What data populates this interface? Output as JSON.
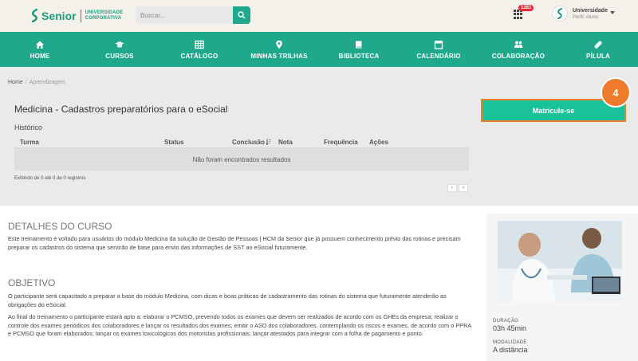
{
  "header": {
    "brand": "Senior",
    "brand_sub_1": "UNIVERSIDADE",
    "brand_sub_2": "CORPORATIVA",
    "search_placeholder": "Buscar...",
    "notifications": "1281",
    "user_name": "Universidade",
    "user_role": "Perfil: Aluno"
  },
  "nav": [
    {
      "label": "HOME",
      "icon": "home-icon"
    },
    {
      "label": "CURSOS",
      "icon": "graduation-cap-icon"
    },
    {
      "label": "CATÁLOGO",
      "icon": "catalog-grid-icon"
    },
    {
      "label": "MINHAS TRILHAS",
      "icon": "map-pin-icon"
    },
    {
      "label": "BIBLIOTECA",
      "icon": "book-icon"
    },
    {
      "label": "CALENDÁRIO",
      "icon": "calendar-icon"
    },
    {
      "label": "COLABORAÇÃO",
      "icon": "users-icon"
    },
    {
      "label": "PÍLULA",
      "icon": "pill-icon"
    }
  ],
  "breadcrumb": {
    "home": "Home",
    "current": "Aprendizagem"
  },
  "course": {
    "title": "Medicina - Cadastros preparatórios para o eSocial",
    "history_label": "Histórico",
    "enroll_label": "Matricule-se",
    "step": "4"
  },
  "table": {
    "columns": [
      "Turma",
      "Status",
      "Conclusão",
      "Nota",
      "Frequência",
      "Ações"
    ],
    "empty": "Não foram encontrados resultados",
    "records": "Exibindo de 0 até 0 de 0 registros",
    "prev": "«",
    "next": "»"
  },
  "details": {
    "title": "DETALHES DO CURSO",
    "text": "Este treinamento é voltado para usuários do módulo Medicina da solução de Gestão de Pessoas | HCM da Senior que já possuem conhecimento prévio das rotinas e precisam preparar os cadastros do sistema que servirão de base para envio das informações de SST ao eSocial futuramente."
  },
  "objective": {
    "title": "OBJETIVO",
    "text1": "O participante será capacitado a preparar a base do módulo Medicina, com dicas e boas práticas de cadastramento das rotinas do sistema que futuramente atenderão as obrigações do eSocial.",
    "text2": "Ao final do treinamento o participante estará apto a: elaborar o PCMSO, prevendo todos os exames que devem ser realizados de acordo com os GHEs da empresa; realizar o controle dos exames periódicos dos colaboradores e lançar os resultados dos exames; emitir o ASO dos colaboradores, contemplando os riscos e exames, de acordo com o PPRA e PCMSO que foram elaborados; lançar os exames toxicológicos dos motoristas profissionais; lançar atestados para integrar com a folha de pagamento e ponto."
  },
  "meta": {
    "duration_label": "DURAÇÃO",
    "duration_value": "03h 45min",
    "mode_label": "MODALIDADE",
    "mode_value": "A distância"
  },
  "colors": {
    "brand": "#1fa88b",
    "enroll": "#19c29a",
    "highlight": "#f07b2c",
    "badge": "#e32b3a"
  }
}
